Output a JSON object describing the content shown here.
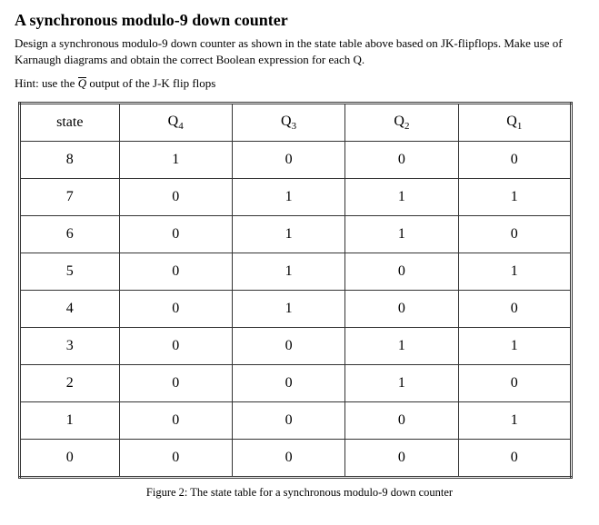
{
  "title": "A synchronous modulo-9 down counter",
  "description": "Design a synchronous modulo-9 down counter as shown in the state table above based on JK-flipflops. Make use of Karnaugh diagrams and obtain the correct Boolean expression for each Q.",
  "hint_prefix": "Hint: use the ",
  "hint_qbar": "Q",
  "hint_suffix": " output of the J-K flip flops",
  "headers": {
    "state": "state",
    "q4": "Q",
    "q4_sub": "4",
    "q3": "Q",
    "q3_sub": "3",
    "q2": "Q",
    "q2_sub": "2",
    "q1": "Q",
    "q1_sub": "1"
  },
  "rows": [
    {
      "state": "8",
      "q4": "1",
      "q3": "0",
      "q2": "0",
      "q1": "0"
    },
    {
      "state": "7",
      "q4": "0",
      "q3": "1",
      "q2": "1",
      "q1": "1"
    },
    {
      "state": "6",
      "q4": "0",
      "q3": "1",
      "q2": "1",
      "q1": "0"
    },
    {
      "state": "5",
      "q4": "0",
      "q3": "1",
      "q2": "0",
      "q1": "1"
    },
    {
      "state": "4",
      "q4": "0",
      "q3": "1",
      "q2": "0",
      "q1": "0"
    },
    {
      "state": "3",
      "q4": "0",
      "q3": "0",
      "q2": "1",
      "q1": "1"
    },
    {
      "state": "2",
      "q4": "0",
      "q3": "0",
      "q2": "1",
      "q1": "0"
    },
    {
      "state": "1",
      "q4": "0",
      "q3": "0",
      "q2": "0",
      "q1": "1"
    },
    {
      "state": "0",
      "q4": "0",
      "q3": "0",
      "q2": "0",
      "q1": "0"
    }
  ],
  "caption": "Figure 2: The state table for a synchronous modulo-9 down counter",
  "chart_data": {
    "type": "table",
    "title": "State table for a synchronous modulo-9 down counter",
    "columns": [
      "state",
      "Q4",
      "Q3",
      "Q2",
      "Q1"
    ],
    "rows": [
      [
        8,
        1,
        0,
        0,
        0
      ],
      [
        7,
        0,
        1,
        1,
        1
      ],
      [
        6,
        0,
        1,
        1,
        0
      ],
      [
        5,
        0,
        1,
        0,
        1
      ],
      [
        4,
        0,
        1,
        0,
        0
      ],
      [
        3,
        0,
        0,
        1,
        1
      ],
      [
        2,
        0,
        0,
        1,
        0
      ],
      [
        1,
        0,
        0,
        0,
        1
      ],
      [
        0,
        0,
        0,
        0,
        0
      ]
    ]
  }
}
